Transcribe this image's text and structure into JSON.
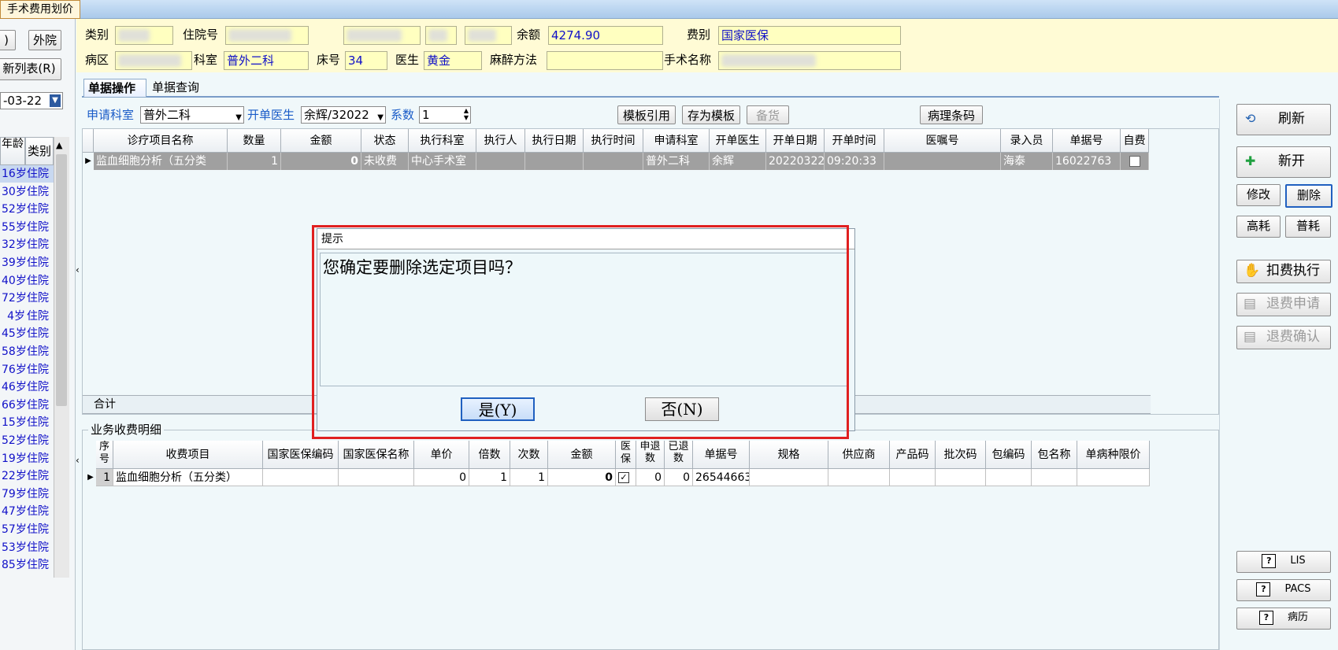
{
  "window": {
    "title": "手术费用划价"
  },
  "left": {
    "btn_paren": ")",
    "btn_outpatient": "外院",
    "btn_newlist": "新列表(R)",
    "date_value": "-03-22",
    "col_age": "年龄",
    "col_type": "类别",
    "rows": [
      {
        "age": "16岁",
        "type": "住院"
      },
      {
        "age": "30岁",
        "type": "住院"
      },
      {
        "age": "52岁",
        "type": "住院"
      },
      {
        "age": "55岁",
        "type": "住院"
      },
      {
        "age": "32岁",
        "type": "住院"
      },
      {
        "age": "39岁",
        "type": "住院"
      },
      {
        "age": "40岁",
        "type": "住院"
      },
      {
        "age": "72岁",
        "type": "住院"
      },
      {
        "age": "4岁",
        "type": "住院"
      },
      {
        "age": "45岁",
        "type": "住院"
      },
      {
        "age": "58岁",
        "type": "住院"
      },
      {
        "age": "76岁",
        "type": "住院"
      },
      {
        "age": "46岁",
        "type": "住院"
      },
      {
        "age": "66岁",
        "type": "住院"
      },
      {
        "age": "15岁",
        "type": "住院"
      },
      {
        "age": "52岁",
        "type": "住院"
      },
      {
        "age": "19岁",
        "type": "住院"
      },
      {
        "age": "22岁",
        "type": "住院"
      },
      {
        "age": "79岁",
        "type": "住院"
      },
      {
        "age": "47岁",
        "type": "住院"
      },
      {
        "age": "57岁",
        "type": "住院"
      },
      {
        "age": "53岁",
        "type": "住院"
      },
      {
        "age": "85岁",
        "type": "住院"
      }
    ]
  },
  "header": {
    "type_label": "类别",
    "inpatient_no_label": "住院号",
    "balance_label": "余额",
    "balance_value": "4274.90",
    "fee_type_label": "费别",
    "fee_type_value": "国家医保",
    "ward_label": "病区",
    "dept_label": "科室",
    "dept_value": "普外二科",
    "bed_label": "床号",
    "bed_value": "34",
    "doctor_label": "医生",
    "doctor_value": "黄金",
    "anesthesia_label": "麻醉方法",
    "anesthesia_value": "",
    "surgery_label": "手术名称"
  },
  "tabs": {
    "ops": "单据操作",
    "query": "单据查询"
  },
  "toolbar": {
    "req_dept_label": "申请科室",
    "req_dept_value": "普外二科",
    "doctor_label": "开单医生",
    "doctor_value": "余辉/32022",
    "coef_label": "系数",
    "coef_value": "1",
    "template_ref": "模板引用",
    "save_template": "存为模板",
    "stock": "备货",
    "pathology": "病理条码"
  },
  "top_grid": {
    "headers": [
      "诊疗项目名称",
      "数量",
      "金额",
      "状态",
      "执行科室",
      "执行人",
      "执行日期",
      "执行时间",
      "申请科室",
      "开单医生",
      "开单日期",
      "开单时间",
      "医嘱号",
      "录入员",
      "单据号",
      "自费"
    ],
    "row": [
      "监血细胞分析（五分类",
      "1",
      "0",
      "未收费",
      "中心手术室",
      "",
      "",
      "",
      "普外二科",
      "余辉",
      "20220322",
      "09:20:33",
      "",
      "海泰",
      "16022763",
      ""
    ],
    "total_label": "合计"
  },
  "detail": {
    "legend": "业务收费明细",
    "headers": [
      "序号",
      "收费项目",
      "国家医保编码",
      "国家医保名称",
      "单价",
      "倍数",
      "次数",
      "金额",
      "医保",
      "申退数",
      "已退数",
      "单据号",
      "规格",
      "供应商",
      "产品码",
      "批次码",
      "包编码",
      "包名称",
      "单病种限价"
    ],
    "row": [
      "1",
      "监血细胞分析（五分类）",
      "",
      "",
      "0",
      "1",
      "1",
      "0",
      "",
      "0",
      "0",
      "26544663",
      "",
      "",
      "",
      "",
      "",
      "",
      ""
    ]
  },
  "right": {
    "refresh": "刷新",
    "new": "新开",
    "edit": "修改",
    "delete": "删除",
    "high": "高耗",
    "normal": "普耗",
    "deduct": "扣费执行",
    "refund_req": "退费申请",
    "refund_confirm": "退费确认",
    "lis": "LIS",
    "pacs": "PACS",
    "record": "病历"
  },
  "dialog": {
    "title": "提示",
    "message": "您确定要删除选定项目吗？",
    "yes": "是(Y)",
    "no": "否(N)"
  },
  "colors": {
    "accent": "#1a5cc8",
    "highlight_border": "#e02020",
    "row_selected": "#a0a0a0"
  }
}
